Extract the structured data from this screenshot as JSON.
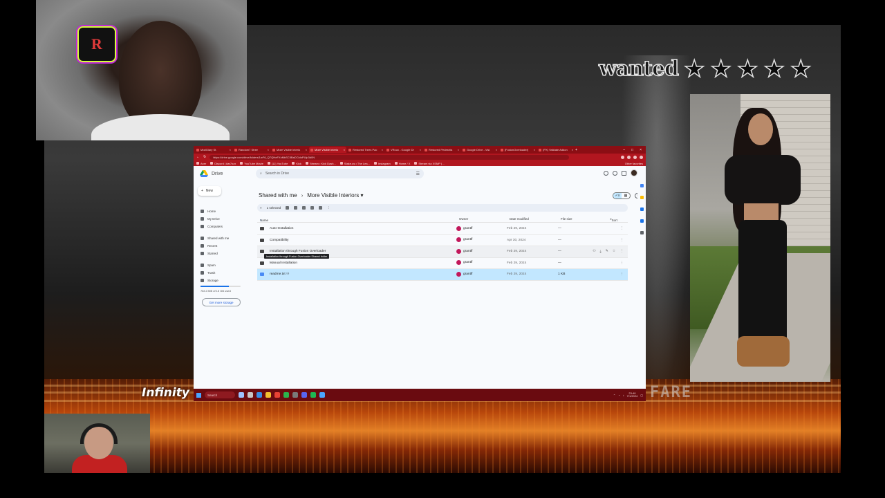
{
  "overlay": {
    "wanted_text": "wanted",
    "stars": [
      "★",
      "★",
      "★",
      "★",
      "★"
    ],
    "infinity_logo": "Infinity",
    "fare_logo": "FARE"
  },
  "browser": {
    "tabs": [
      {
        "label": "ModGlary St."
      },
      {
        "label": "Random7 Stree"
      },
      {
        "label": "More Visible Interio"
      },
      {
        "label": "More Visible Interio"
      },
      {
        "label": "Restored Trees Pac"
      },
      {
        "label": "VRoux - Google Dr"
      },
      {
        "label": "Restored Pedestria"
      },
      {
        "label": "Google Drive - Visi"
      },
      {
        "label": "[FusionOverloader]"
      },
      {
        "label": "(PX) Validate Addon"
      }
    ],
    "url": "https://drive.google.com/drive/folders/1wF6_QTQHeFXxMbSC5BaDCidoPUlp3d0N",
    "bookmarks": [
      "Axer",
      "Discord | #ar7ozx",
      "YouTube Movie",
      "(11) YouTube",
      "Kick",
      "Stream • Kick Dash...",
      "Stake.us • The Lea...",
      "Instagram",
      "Home / X",
      "Stream via XSMP | ..."
    ],
    "bookmarks_other": "Other favorites"
  },
  "drive": {
    "app_name": "Drive",
    "new_label": "New",
    "nav": [
      "Home",
      "My Drive",
      "Computers",
      "Shared with me",
      "Recent",
      "Starred",
      "Spam",
      "Trash",
      "Storage"
    ],
    "storage_text": "783.3 MB of 15 GB used",
    "get_more_storage": "Get more storage",
    "search_placeholder": "Search in Drive",
    "breadcrumb_parent": "Shared with me",
    "breadcrumb_sep": "›",
    "breadcrumb_current": "More Visible Interiors ▾",
    "selection_text": "1 selected",
    "columns": {
      "name": "Name",
      "owner": "Owner",
      "date": "Date modified",
      "size": "File size",
      "sort": "Sort"
    },
    "files": [
      {
        "name": "Auto-Installation",
        "owner": "grantlf",
        "date": "Feb 29, 2024",
        "size": "—"
      },
      {
        "name": "Compatibility",
        "owner": "grantlf",
        "date": "Apr 30, 2024",
        "size": "—"
      },
      {
        "name": "Installation through Fusion Overloader",
        "owner": "grantlf",
        "date": "Feb 29, 2024",
        "size": "—"
      },
      {
        "name": "Manual Installation",
        "owner": "grantlf",
        "date": "Feb 29, 2024",
        "size": "—"
      },
      {
        "name": "readme.txt",
        "owner": "grantlf",
        "date": "Feb 29, 2024",
        "size": "1 KB"
      }
    ],
    "tooltip": "Installation through Fusion Overloader Shared folder"
  },
  "taskbar": {
    "search_label": "Search",
    "time": "23:40",
    "date": "7/1/2024"
  },
  "colors": {
    "chrome_red": "#b1161f",
    "selected_row": "#c2e7ff",
    "avatar_pink": "#c2185b"
  }
}
